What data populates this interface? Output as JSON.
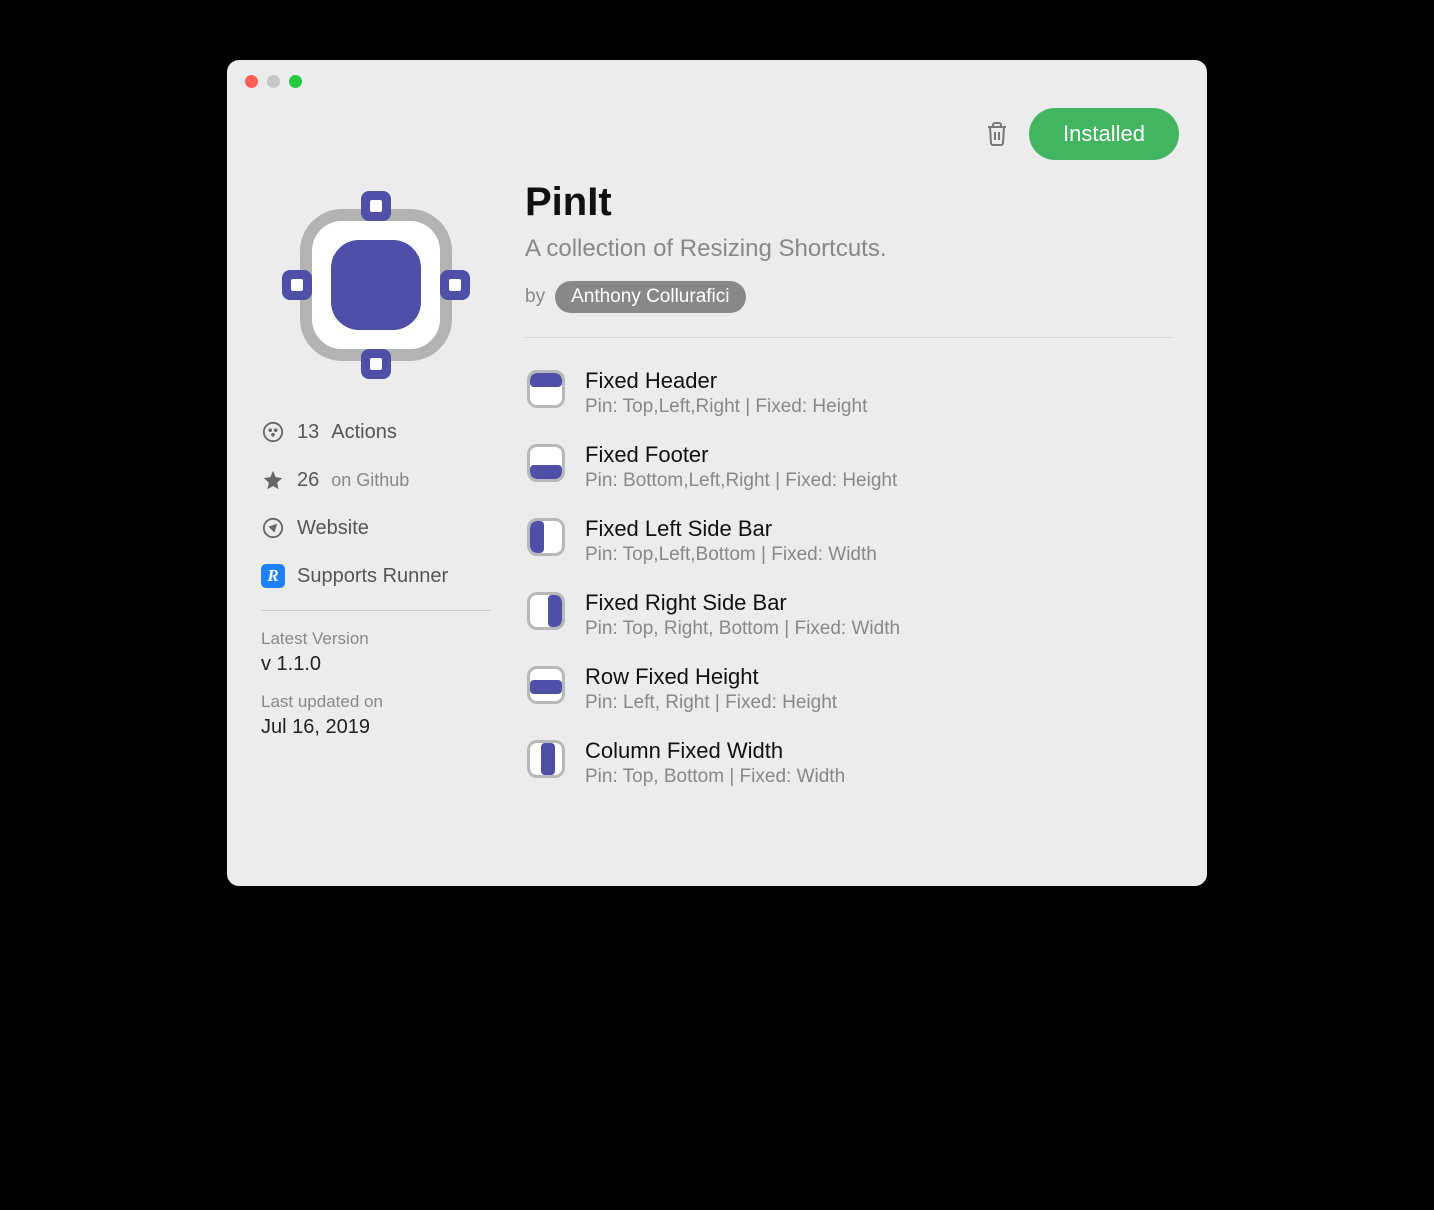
{
  "toolbar": {
    "installed_label": "Installed"
  },
  "plugin": {
    "title": "PinIt",
    "description": "A collection of Resizing Shortcuts.",
    "by_label": "by",
    "author": "Anthony Collurafici"
  },
  "sidebar": {
    "actions_count": "13",
    "actions_label": "Actions",
    "stars_count": "26",
    "stars_label": "on Github",
    "website_label": "Website",
    "runner_label": "Supports Runner",
    "latest_version_label": "Latest Version",
    "latest_version": "v 1.1.0",
    "updated_label": "Last updated on",
    "updated_date": "Jul 16, 2019"
  },
  "actions": [
    {
      "icon": "header",
      "title": "Fixed Header",
      "desc": "Pin: Top,Left,Right | Fixed: Height"
    },
    {
      "icon": "footer",
      "title": "Fixed Footer",
      "desc": "Pin: Bottom,Left,Right | Fixed: Height"
    },
    {
      "icon": "left",
      "title": "Fixed Left Side Bar",
      "desc": "Pin: Top,Left,Bottom | Fixed: Width"
    },
    {
      "icon": "right",
      "title": "Fixed Right Side Bar",
      "desc": "Pin: Top, Right, Bottom | Fixed: Width"
    },
    {
      "icon": "row",
      "title": "Row Fixed Height",
      "desc": "Pin: Left, Right | Fixed: Height"
    },
    {
      "icon": "col",
      "title": "Column Fixed Width",
      "desc": "Pin: Top, Bottom | Fixed: Width"
    }
  ]
}
